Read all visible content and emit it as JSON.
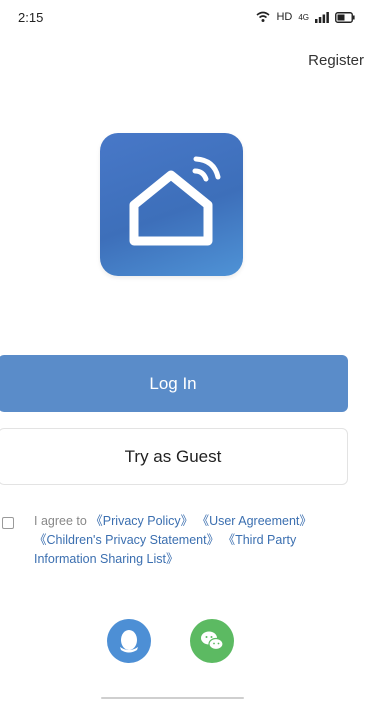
{
  "status_bar": {
    "time": "2:15",
    "network_label": "HD",
    "signal_label": "4G",
    "icons": [
      "wifi-icon",
      "signal-icon",
      "battery-icon"
    ]
  },
  "header": {
    "register_label": "Register"
  },
  "app_logo": {
    "icon": "smart-home-icon",
    "colors": {
      "primary": "#3d6fba",
      "secondary": "#4f93d6"
    }
  },
  "buttons": {
    "login_label": "Log In",
    "guest_label": "Try as Guest"
  },
  "agreement": {
    "checked": false,
    "prefix": "I agree to ",
    "links": [
      "《Privacy Policy》",
      "《User Agreement》",
      "《Children's Privacy Statement》",
      "《Third Party Information Sharing List》"
    ]
  },
  "social_login": [
    {
      "name": "qq",
      "icon": "qq-penguin-icon",
      "color": "#4d8fd5"
    },
    {
      "name": "wechat",
      "icon": "wechat-icon",
      "color": "#5cba62"
    }
  ],
  "colors": {
    "accent": "#5a8cc9",
    "link": "#3b6fb0"
  }
}
